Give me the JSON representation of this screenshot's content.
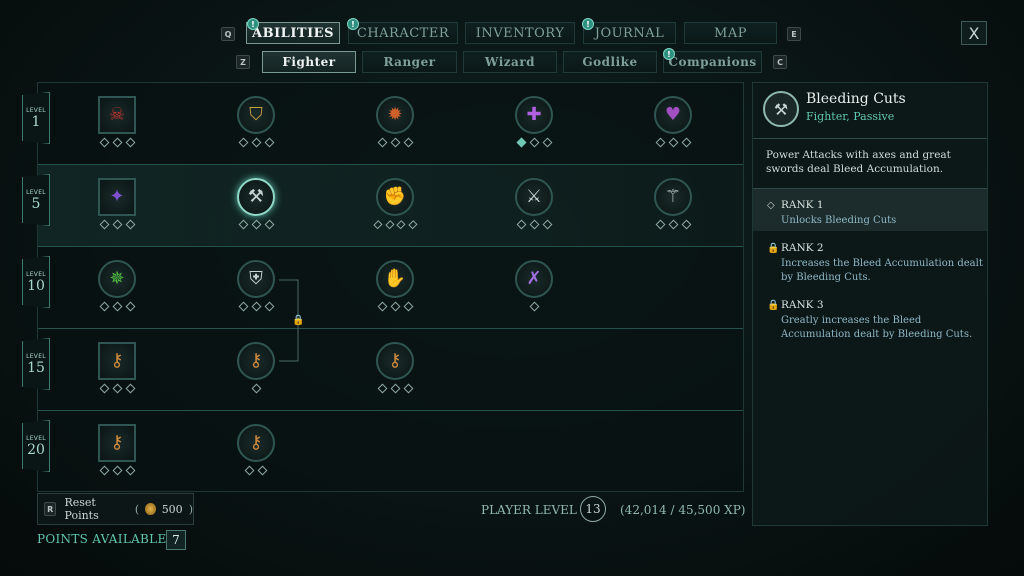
{
  "nav": {
    "keys": {
      "left": "Q",
      "right": "E",
      "sub_left": "Z",
      "sub_right": "C"
    },
    "tabs": [
      {
        "label": "ABILITIES",
        "active": true,
        "alert": true
      },
      {
        "label": "CHARACTER",
        "active": false,
        "alert": true
      },
      {
        "label": "INVENTORY",
        "active": false,
        "alert": false
      },
      {
        "label": "JOURNAL",
        "active": false,
        "alert": true
      },
      {
        "label": "MAP",
        "active": false,
        "alert": false
      }
    ],
    "subtabs": [
      {
        "label": "Fighter",
        "active": true,
        "alert": false
      },
      {
        "label": "Ranger",
        "active": false,
        "alert": false
      },
      {
        "label": "Wizard",
        "active": false,
        "alert": false
      },
      {
        "label": "Godlike",
        "active": false,
        "alert": false
      },
      {
        "label": "Companions",
        "active": false,
        "alert": true
      }
    ],
    "alert_glyph": "!",
    "close_label": "X"
  },
  "levels": [
    {
      "label": "LEVEL",
      "num": "1"
    },
    {
      "label": "LEVEL",
      "num": "5"
    },
    {
      "label": "LEVEL",
      "num": "10"
    },
    {
      "label": "LEVEL",
      "num": "15"
    },
    {
      "label": "LEVEL",
      "num": "20"
    }
  ],
  "skills": [
    {
      "row": 0,
      "col": 0,
      "shape": "square",
      "icon": "demon-mask-icon",
      "glyph": "☠",
      "color": "#c0302a",
      "pips": 3,
      "filled": 0
    },
    {
      "row": 0,
      "col": 1,
      "shape": "circle",
      "icon": "shield-burst-icon",
      "glyph": "⛉",
      "color": "#c8a040",
      "pips": 3,
      "filled": 0
    },
    {
      "row": 0,
      "col": 2,
      "shape": "circle",
      "icon": "flame-shield-icon",
      "glyph": "✹",
      "color": "#d0602a",
      "pips": 3,
      "filled": 0
    },
    {
      "row": 0,
      "col": 3,
      "shape": "circle",
      "icon": "holy-cross-icon",
      "glyph": "✚",
      "color": "#b060e0",
      "pips": 3,
      "filled": 1
    },
    {
      "row": 0,
      "col": 4,
      "shape": "circle",
      "icon": "heart-icon",
      "glyph": "♥",
      "color": "#a050c0",
      "pips": 3,
      "filled": 0
    },
    {
      "row": 1,
      "col": 0,
      "shape": "square",
      "icon": "claw-slash-icon",
      "glyph": "✦",
      "color": "#8050d0",
      "pips": 3,
      "filled": 0
    },
    {
      "row": 1,
      "col": 1,
      "shape": "circle",
      "icon": "bleeding-axe-icon",
      "glyph": "⚒",
      "color": "#c8d4d0",
      "pips": 3,
      "filled": 0,
      "selected": true
    },
    {
      "row": 1,
      "col": 2,
      "shape": "circle",
      "icon": "fist-icon",
      "glyph": "✊",
      "color": "#c8d4d0",
      "pips": 4,
      "filled": 0
    },
    {
      "row": 1,
      "col": 3,
      "shape": "circle",
      "icon": "warrior-icon",
      "glyph": "⚔",
      "color": "#c8d4d0",
      "pips": 3,
      "filled": 0
    },
    {
      "row": 1,
      "col": 4,
      "shape": "circle",
      "icon": "battle-axe-icon",
      "glyph": "⚚",
      "color": "#c8d4d0",
      "pips": 3,
      "filled": 0
    },
    {
      "row": 2,
      "col": 0,
      "shape": "circle",
      "icon": "green-flame-icon",
      "glyph": "✵",
      "color": "#50c040",
      "pips": 3,
      "filled": 0
    },
    {
      "row": 2,
      "col": 1,
      "shape": "circle",
      "icon": "broken-shield-icon",
      "glyph": "⛨",
      "color": "#c8d4d0",
      "pips": 3,
      "filled": 0
    },
    {
      "row": 2,
      "col": 2,
      "shape": "circle",
      "icon": "gauntlet-icon",
      "glyph": "✋",
      "color": "#c8d4d0",
      "pips": 3,
      "filled": 0
    },
    {
      "row": 2,
      "col": 3,
      "shape": "circle",
      "icon": "crossed-swords-icon",
      "glyph": "✗",
      "color": "#a070e0",
      "pips": 1,
      "filled": 0
    },
    {
      "row": 3,
      "col": 0,
      "shape": "square",
      "icon": "locked-rune-icon",
      "glyph": "⚷",
      "color": "#d08a3a",
      "pips": 3,
      "filled": 0
    },
    {
      "row": 3,
      "col": 1,
      "shape": "circle",
      "icon": "locked-shield-icon",
      "glyph": "⚷",
      "color": "#d08a3a",
      "pips": 1,
      "filled": 0
    },
    {
      "row": 3,
      "col": 2,
      "shape": "circle",
      "icon": "locked-gauntlet-icon",
      "glyph": "⚷",
      "color": "#d08a3a",
      "pips": 3,
      "filled": 0
    },
    {
      "row": 4,
      "col": 0,
      "shape": "square",
      "icon": "locked-whirl-icon",
      "glyph": "⚷",
      "color": "#d08a3a",
      "pips": 3,
      "filled": 0
    },
    {
      "row": 4,
      "col": 1,
      "shape": "circle",
      "icon": "locked-warrior-icon",
      "glyph": "⚷",
      "color": "#d08a3a",
      "pips": 2,
      "filled": 0
    }
  ],
  "footer": {
    "reset_key": "R",
    "reset_label": "Reset Points",
    "reset_cost_open": "(",
    "reset_cost": "500",
    "reset_cost_close": ")",
    "player_level_label": "PLAYER LEVEL",
    "player_level": "13",
    "xp_text": "(42,014 / 45,500 XP)",
    "points_available_label": "POINTS AVAILABLE",
    "points_available": "7"
  },
  "detail": {
    "title": "Bleeding Cuts",
    "subtitle": "Fighter, Passive",
    "description": "Power Attacks with axes and great swords deal Bleed Accumulation.",
    "ranks": [
      {
        "title": "RANK 1",
        "desc": "Unlocks Bleeding Cuts",
        "locked": false
      },
      {
        "title": "RANK 2",
        "desc": "Increases the Bleed Accumulation dealt by Bleeding Cuts.",
        "locked": true
      },
      {
        "title": "RANK 3",
        "desc": "Greatly increases the Bleed Accumulation dealt by Bleeding Cuts.",
        "locked": true
      }
    ]
  },
  "colors": {
    "accent": "#5fc8b0",
    "lock": "#d08a3a"
  }
}
